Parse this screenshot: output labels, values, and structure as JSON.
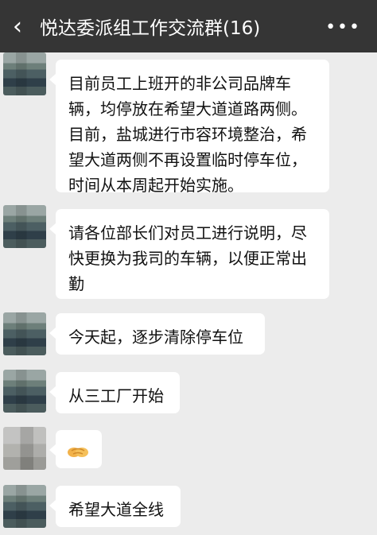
{
  "header": {
    "back_icon": "chevron-left-icon",
    "title": "悦达委派组工作交流群(16)",
    "more_icon": "ellipsis-icon"
  },
  "messages": [
    {
      "text": "目前员工上班开的非公司品牌车辆，均停放在希望大道道路两侧。目前，盐城进行市容环境整治，希望大道两侧不再设置临时停车位，时间从本周起开始实施。"
    },
    {
      "text": "请各位部长们对员工进行说明，尽快更换为我司的车辆，以便正常出勤"
    },
    {
      "text": "今天起，逐步清除停车位"
    },
    {
      "text": "从三工厂开始"
    },
    {
      "emoji": "handshake-icon"
    },
    {
      "text": "希望大道全线"
    }
  ]
}
